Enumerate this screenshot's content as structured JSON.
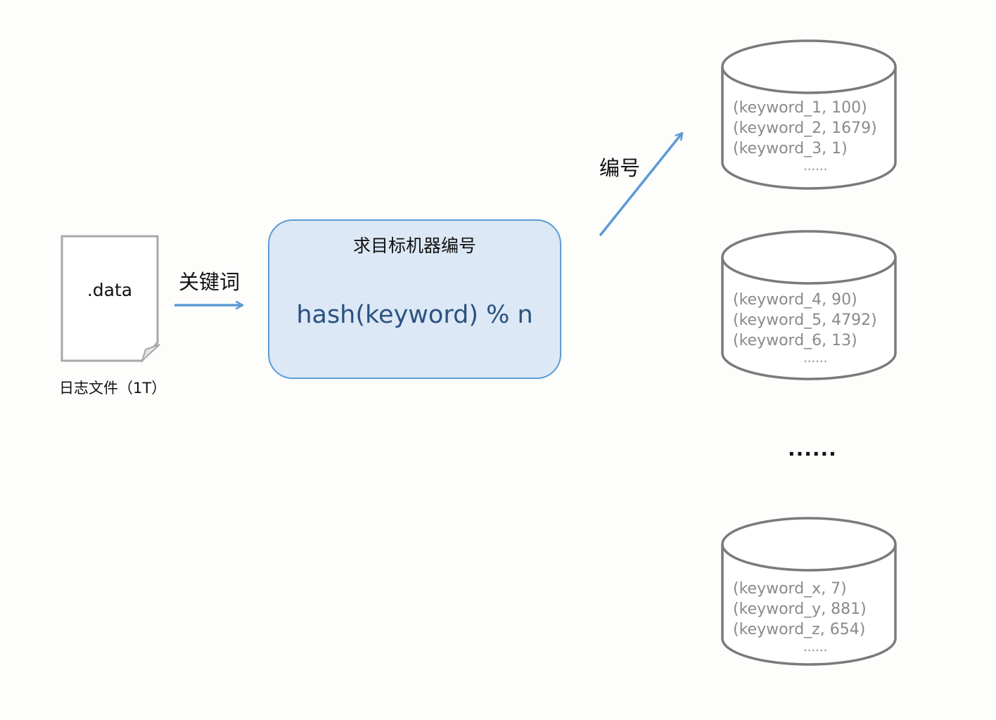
{
  "source_file": {
    "name": ".data",
    "caption": "日志文件（1T）"
  },
  "edges": {
    "to_hash": "关键词",
    "to_machine": "编号"
  },
  "hash_box": {
    "title": "求目标机器编号",
    "formula": "hash(keyword) % n"
  },
  "machines": [
    {
      "records": [
        "(keyword_1, 100)",
        "(keyword_2, 1679)",
        "(keyword_3, 1)"
      ],
      "more": "......"
    },
    {
      "records": [
        "(keyword_4, 90)",
        "(keyword_5, 4792)",
        "(keyword_6, 13)"
      ],
      "more": "......"
    },
    {
      "records": [
        "(keyword_x, 7)",
        "(keyword_y, 881)",
        "(keyword_z, 654)"
      ],
      "more": "......"
    }
  ],
  "machines_ellipsis": "......",
  "colors": {
    "arrow": "#5b9bd5",
    "box_fill": "#dce8f5",
    "box_stroke": "#5b9bd5",
    "db_stroke": "#7a7a7a",
    "file_stroke": "#a8a8a8",
    "formula_text": "#2a5280"
  }
}
